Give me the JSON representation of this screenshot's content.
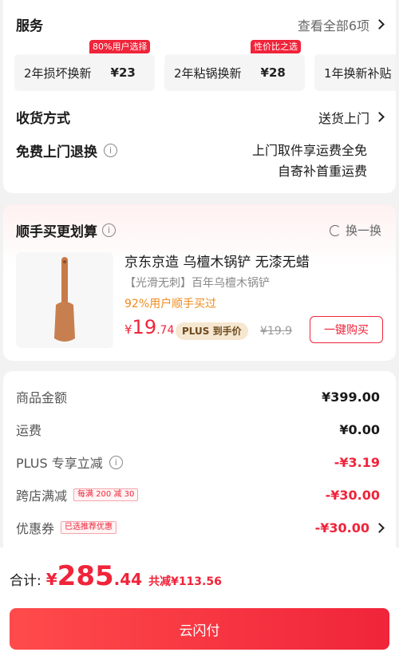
{
  "service": {
    "title": "服务",
    "view_all": "查看全部6项",
    "options": [
      {
        "name": "2年损坏换新",
        "price": "¥23",
        "badge": "80%用户选择"
      },
      {
        "name": "2年粘锅换新",
        "price": "¥28",
        "badge": "性价比之选"
      },
      {
        "name": "1年换新补贴",
        "price": "",
        "badge": ""
      }
    ],
    "delivery_label": "收货方式",
    "delivery_value": "送货上门",
    "return_label": "免费上门退换",
    "return_value_line1": "上门取件享运费全免",
    "return_value_line2": "自寄补首重运费"
  },
  "bundle": {
    "title": "顺手买更划算",
    "refresh": "换一换",
    "product": {
      "title": "京东京造 乌檀木锅铲 无漆无蜡",
      "subtitle": "【光滑无刺】百年乌檀木锅铲",
      "stat": "92%用户顺手买过",
      "price_currency": "¥",
      "price_int": "19",
      "price_dec": ".74",
      "plus_label": "PLUS 到手价",
      "orig_price": "¥19.9",
      "buy_label": "一键购买"
    }
  },
  "price_list": [
    {
      "label": "商品金额",
      "value": "¥399.00",
      "tag": "",
      "red": false
    },
    {
      "label": "运费",
      "value": "¥0.00",
      "tag": "",
      "red": false
    },
    {
      "label": "PLUS 专享立减",
      "value": "-¥3.19",
      "tag": "",
      "red": true
    },
    {
      "label": "跨店满减",
      "value": "-¥30.00",
      "tag": "每满 200 减 30",
      "red": true
    },
    {
      "label": "优惠券",
      "value": "-¥30.00",
      "tag": "已选推荐优惠",
      "red": true
    }
  ],
  "footer": {
    "total_label": "合计:",
    "currency": "¥",
    "total_int": "285",
    "total_dec": ".44",
    "saved": "共减¥113.56",
    "pay_label": "云闪付"
  },
  "colors": {
    "accent": "#f0243a",
    "orange": "#f08a1c"
  }
}
